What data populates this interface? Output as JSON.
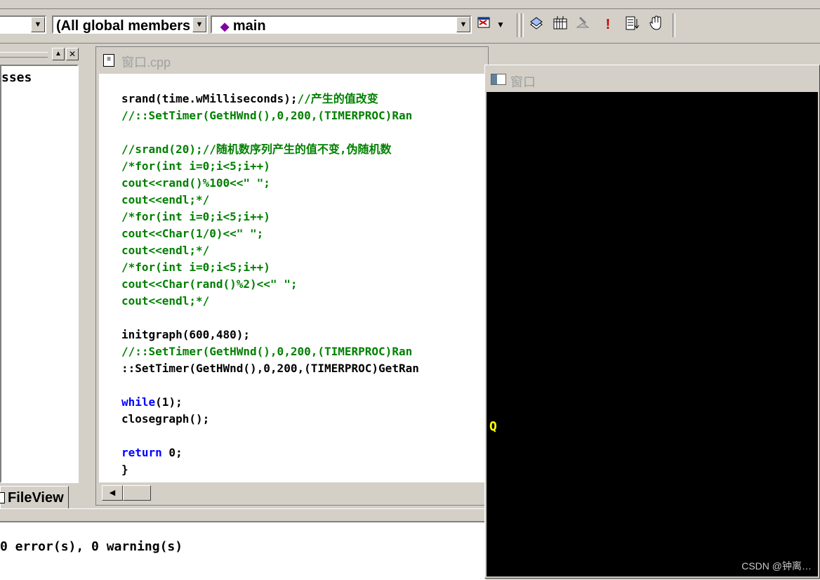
{
  "toolbar": {
    "scope_combo_value": "",
    "members_combo_value": "(All global members",
    "function_combo_value": "main"
  },
  "left_panel": {
    "tree_text": "sses",
    "tab_label": "FileView"
  },
  "editor": {
    "title": "窗口.cpp",
    "lines": [
      {
        "parts": [
          {
            "t": "srand(time.wMilliseconds);",
            "c": ""
          },
          {
            "t": "//产生的值改变",
            "c": "cm"
          }
        ]
      },
      {
        "parts": [
          {
            "t": "//::SetTimer(GetHWnd(),0,200,(TIMERPROC)Ran",
            "c": "cm"
          }
        ]
      },
      {
        "parts": []
      },
      {
        "parts": [
          {
            "t": "//srand(20);//随机数序列产生的值不变,伪随机数",
            "c": "cm"
          }
        ]
      },
      {
        "parts": [
          {
            "t": "/*for(int i=0;i<5;i++)",
            "c": "cm"
          }
        ]
      },
      {
        "parts": [
          {
            "t": "cout<<rand()%100<<\" \";",
            "c": "cm"
          }
        ]
      },
      {
        "parts": [
          {
            "t": "cout<<endl;*/",
            "c": "cm"
          }
        ]
      },
      {
        "parts": [
          {
            "t": "/*for(int i=0;i<5;i++)",
            "c": "cm"
          }
        ]
      },
      {
        "parts": [
          {
            "t": "cout<<Char(1/0)<<\" \";",
            "c": "cm"
          }
        ]
      },
      {
        "parts": [
          {
            "t": "cout<<endl;*/",
            "c": "cm"
          }
        ]
      },
      {
        "parts": [
          {
            "t": "/*for(int i=0;i<5;i++)",
            "c": "cm"
          }
        ]
      },
      {
        "parts": [
          {
            "t": "cout<<Char(rand()%2)<<\" \";",
            "c": "cm"
          }
        ]
      },
      {
        "parts": [
          {
            "t": "cout<<endl;*/",
            "c": "cm"
          }
        ]
      },
      {
        "parts": []
      },
      {
        "parts": [
          {
            "t": "initgraph(600,480);",
            "c": ""
          }
        ]
      },
      {
        "parts": [
          {
            "t": "//::SetTimer(GetHWnd(),0,200,(TIMERPROC)Ran",
            "c": "cm"
          }
        ]
      },
      {
        "parts": [
          {
            "t": "::SetTimer(GetHWnd(),0,200,(TIMERPROC)GetRan",
            "c": ""
          }
        ]
      },
      {
        "parts": []
      },
      {
        "parts": [
          {
            "t": "while",
            "c": "kw"
          },
          {
            "t": "(1);",
            "c": ""
          }
        ]
      },
      {
        "parts": [
          {
            "t": "closegraph();",
            "c": ""
          }
        ]
      },
      {
        "parts": []
      },
      {
        "parts": [
          {
            "t": "return",
            "c": "kw"
          },
          {
            "t": " 0;",
            "c": ""
          }
        ]
      },
      {
        "parts": [
          {
            "t": "}",
            "c": ""
          }
        ]
      }
    ]
  },
  "output": {
    "text": "0 error(s), 0 warning(s)"
  },
  "graphics_window": {
    "title": "窗口",
    "drawn_char": "Q"
  },
  "watermark": "CSDN @钟离…",
  "colors": {
    "comment": "#008000",
    "keyword": "#0000ff",
    "gfx_text": "#ffff00",
    "gfx_bg": "#000000",
    "chrome": "#d4d0c8"
  }
}
